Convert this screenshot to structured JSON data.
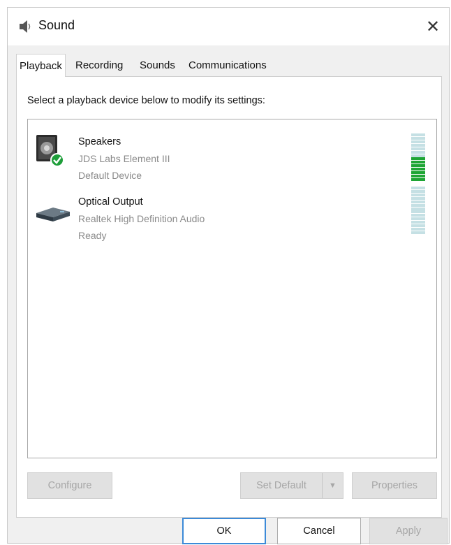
{
  "window": {
    "title": "Sound",
    "close_icon": "close-icon",
    "title_icon": "speaker-icon"
  },
  "tabs": [
    {
      "label": "Playback",
      "active": true
    },
    {
      "label": "Recording",
      "active": false
    },
    {
      "label": "Sounds",
      "active": false
    },
    {
      "label": "Communications",
      "active": false
    }
  ],
  "playback": {
    "instruction": "Select a playback device below to modify its settings:",
    "devices": [
      {
        "name": "Speakers",
        "description": "JDS Labs Element III",
        "status": "Default Device",
        "icon": "speaker-default-icon",
        "is_default": true,
        "level_active_segments": 7,
        "level_total_segments": 14
      },
      {
        "name": "Optical Output",
        "description": "Realtek High Definition Audio",
        "status": "Ready",
        "icon": "optical-output-icon",
        "is_default": false,
        "level_active_segments": 0,
        "level_total_segments": 14
      }
    ],
    "buttons": {
      "configure": "Configure",
      "set_default": "Set Default",
      "properties": "Properties"
    }
  },
  "dialog_buttons": {
    "ok": "OK",
    "cancel": "Cancel",
    "apply": "Apply"
  },
  "colors": {
    "level_on": "#1ea535",
    "level_off": "#c5e0e4",
    "focus_border": "#3c8ad8"
  }
}
